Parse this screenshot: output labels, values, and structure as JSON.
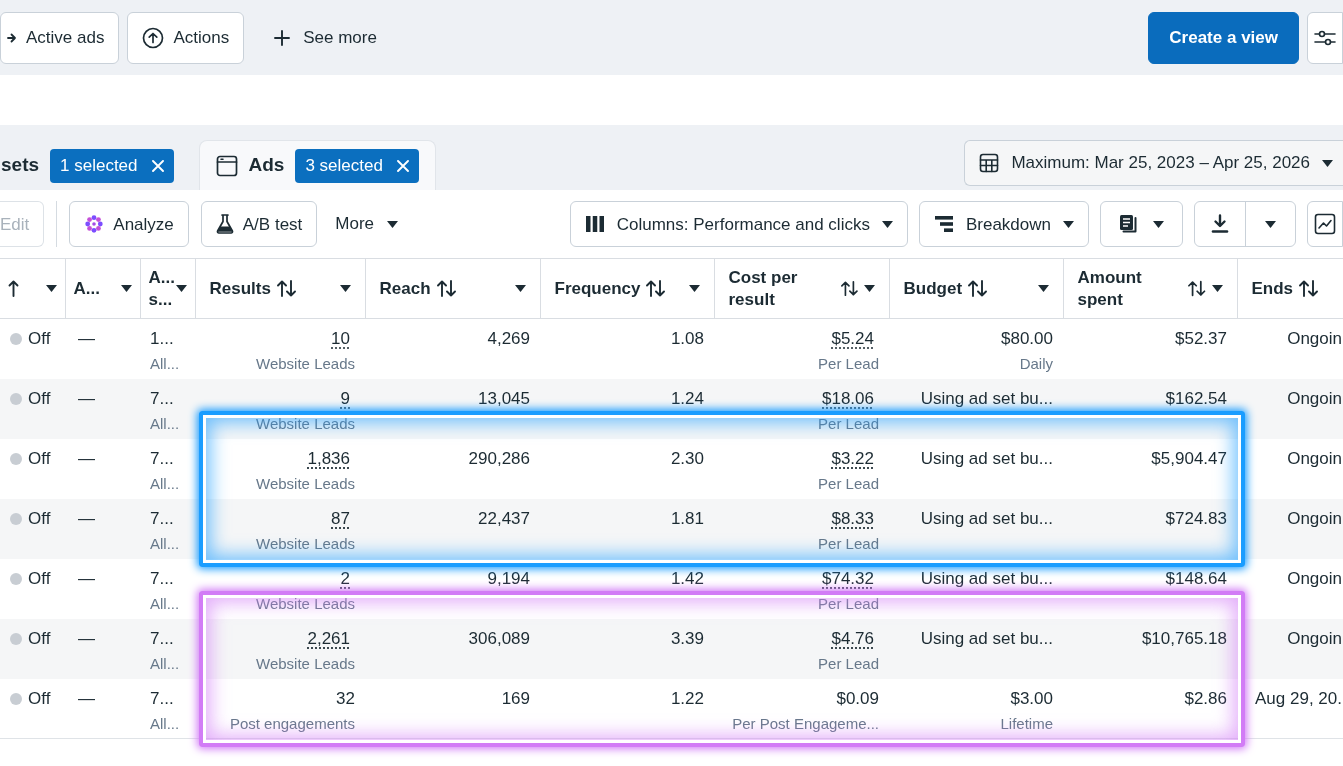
{
  "top_bar": {
    "filters": [
      {
        "label": "Active ads"
      },
      {
        "label": "Actions"
      }
    ],
    "see_more": "See more",
    "create_view": "Create a view"
  },
  "level_tabs": [
    {
      "label": "sets",
      "badge": "1 selected",
      "selected": false
    },
    {
      "label": "Ads",
      "badge": "3 selected",
      "selected": true
    }
  ],
  "date_range": "Maximum: Mar 25, 2023 – Apr 25, 2026",
  "toolbar": {
    "edit": {
      "label": "Edit",
      "disabled": true
    },
    "analyze": "Analyze",
    "ab_test": "A/B test",
    "more": "More",
    "columns": "Columns: Performance and clicks",
    "breakdown": "Breakdown"
  },
  "table": {
    "columns": [
      {
        "sortable": true,
        "sorted": true,
        "menu": true
      },
      {
        "label": "A...",
        "sortable": false,
        "menu": true
      },
      {
        "label": "A... s...",
        "sortable": false,
        "menu": true
      },
      {
        "label": "Results",
        "sortable": true,
        "sorted": false,
        "menu": true
      },
      {
        "label": "Reach",
        "sortable": true,
        "sorted": false,
        "menu": true
      },
      {
        "label": "Frequency",
        "sortable": true,
        "sorted": false,
        "menu": true
      },
      {
        "label": "Cost per result",
        "sortable": true,
        "sorted": false,
        "menu": true
      },
      {
        "label": "Budget",
        "sortable": true,
        "sorted": false,
        "menu": true
      },
      {
        "label": "Amount spent",
        "sortable": true,
        "sorted": false,
        "menu": true
      },
      {
        "label": "Ends",
        "sortable": true,
        "sorted": false,
        "menu": false
      }
    ],
    "rows": [
      {
        "on": false,
        "state": "Off",
        "column_1": "—",
        "column_2": "1...",
        "column_2_sub": "All...",
        "results": "10",
        "result_type": "Website Leads",
        "reach": "4,269",
        "frequency": "1.08",
        "cost_per_result": "$5.24",
        "cost_unit": "Per Lead",
        "budget": "$80.00",
        "budget_type": "Daily",
        "amount_spent": "$52.37",
        "ends": "Ongoin",
        "linked": true
      },
      {
        "on": false,
        "state": "Off",
        "column_1": "—",
        "column_2": "7...",
        "column_2_sub": "All...",
        "results": "9",
        "result_type": "Website Leads",
        "reach": "13,045",
        "frequency": "1.24",
        "cost_per_result": "$18.06",
        "cost_unit": "Per Lead",
        "budget": "Using ad set bu...",
        "amount_spent": "$162.54",
        "ends": "Ongoin",
        "linked": true
      },
      {
        "on": false,
        "state": "Off",
        "column_1": "—",
        "column_2": "7...",
        "column_2_sub": "All...",
        "results": "1,836",
        "result_type": "Website Leads",
        "reach": "290,286",
        "frequency": "2.30",
        "cost_per_result": "$3.22",
        "cost_unit": "Per Lead",
        "budget": "Using ad set bu...",
        "amount_spent": "$5,904.47",
        "ends": "Ongoin",
        "linked": true,
        "highlight": {
          "color": "#1a9dff"
        }
      },
      {
        "on": false,
        "state": "Off",
        "column_1": "—",
        "column_2": "7...",
        "column_2_sub": "All...",
        "results": "87",
        "result_type": "Website Leads",
        "reach": "22,437",
        "frequency": "1.81",
        "cost_per_result": "$8.33",
        "cost_unit": "Per Lead",
        "budget": "Using ad set bu...",
        "amount_spent": "$724.83",
        "ends": "Ongoin",
        "linked": true,
        "highlight": {
          "color": "#1a9dff"
        }
      },
      {
        "on": false,
        "state": "Off",
        "column_1": "—",
        "column_2": "7...",
        "column_2_sub": "All...",
        "results": "2",
        "result_type": "Website Leads",
        "reach": "9,194",
        "frequency": "1.42",
        "cost_per_result": "$74.32",
        "cost_unit": "Per Lead",
        "budget": "Using ad set bu...",
        "amount_spent": "$148.64",
        "ends": "Ongoin",
        "linked": true
      },
      {
        "on": false,
        "state": "Off",
        "column_1": "—",
        "column_2": "7...",
        "column_2_sub": "All...",
        "results": "2,261",
        "result_type": "Website Leads",
        "reach": "306,089",
        "frequency": "3.39",
        "cost_per_result": "$4.76",
        "cost_unit": "Per Lead",
        "budget": "Using ad set bu...",
        "amount_spent": "$10,765.18",
        "ends": "Ongoin",
        "linked": true,
        "highlight": {
          "color": "#d27cf6"
        }
      },
      {
        "on": false,
        "state": "Off",
        "column_1": "—",
        "column_2": "7...",
        "column_2_sub": "All...",
        "results": "32",
        "result_type": "Post engagements",
        "reach": "169",
        "frequency": "1.22",
        "cost_per_result": "$0.09",
        "cost_unit": "Per Post Engageme...",
        "budget": "$3.00",
        "budget_type": "Lifetime",
        "amount_spent": "$2.86",
        "ends": "Aug 29, 20.",
        "linked": false,
        "highlight": {
          "color": "#d27cf6"
        }
      }
    ]
  }
}
